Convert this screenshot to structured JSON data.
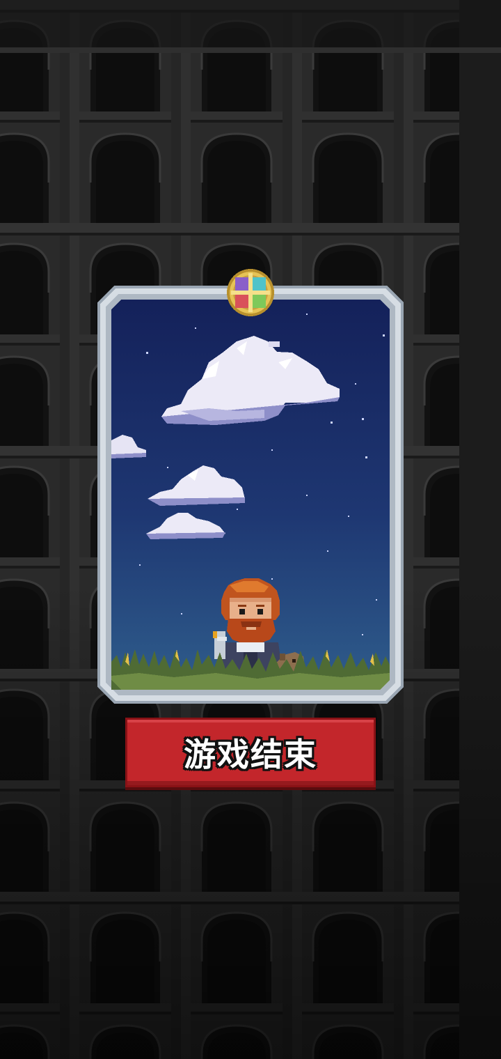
{
  "screen": {
    "name": "game-over",
    "background_color": "#1c1c1c",
    "wall_color": "#2b2b2b",
    "arch_color": "#111111"
  },
  "card": {
    "frame_color": "#c4cdd6",
    "sky_top_color": "#14215a",
    "sky_bottom_color": "#2f5d8c",
    "emblem_icon": "four-color-cross-emblem",
    "hero_icon": "bearded-red-hair-hero",
    "pet_icon": "small-brown-dog",
    "grass_color": "#4f6b34"
  },
  "result_button": {
    "label": "游戏结束",
    "color": "#c3262b"
  }
}
